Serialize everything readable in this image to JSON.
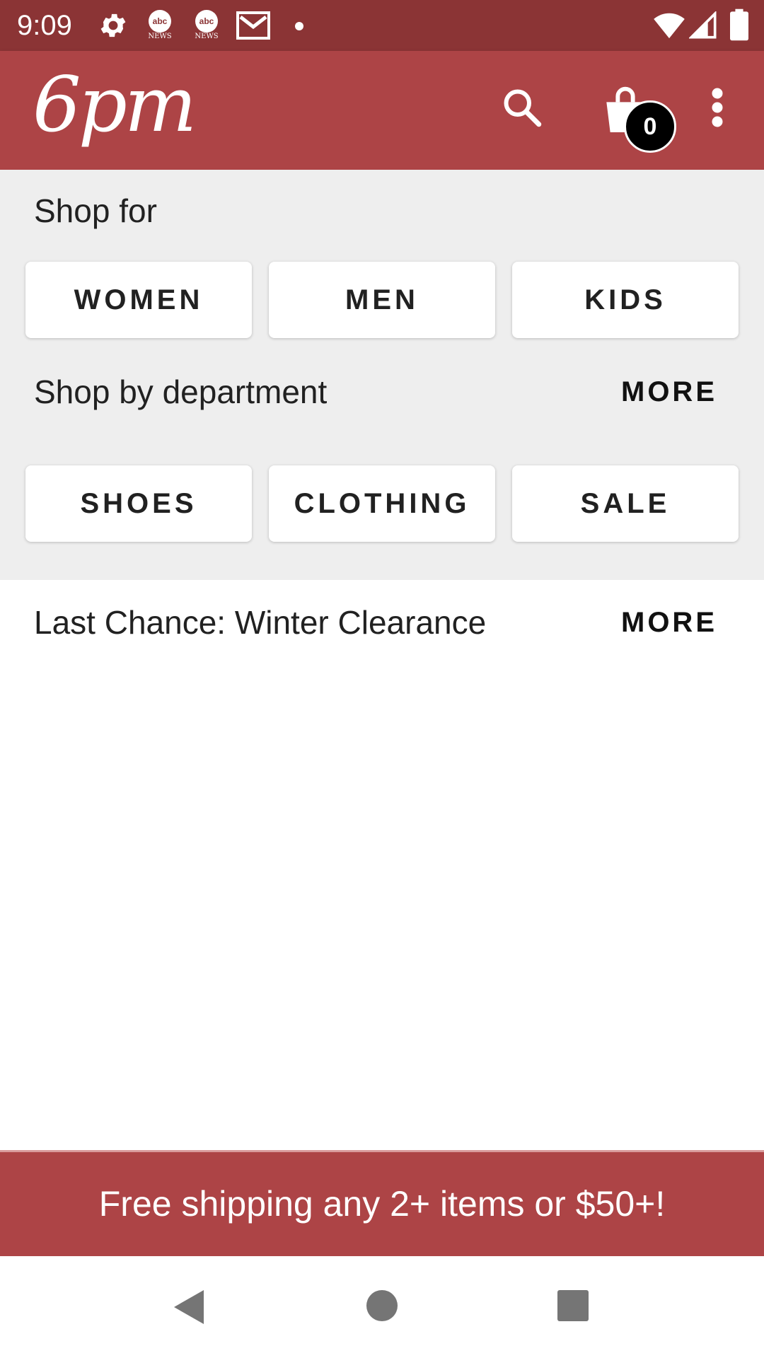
{
  "status_bar": {
    "time": "9:09",
    "icons": [
      "settings-icon",
      "abc-news-icon",
      "abc-news-icon",
      "gmail-icon",
      "dot-icon",
      "wifi-icon",
      "signal-icon",
      "battery-icon"
    ],
    "abc_label": "abc",
    "abc_sub": "NEWS"
  },
  "app_bar": {
    "logo_text": "6pm",
    "cart_count": "0",
    "icons": [
      "search-icon",
      "shopping-bag-icon",
      "overflow-menu-icon"
    ]
  },
  "shop_for": {
    "label": "Shop for",
    "buttons": [
      "WOMEN",
      "MEN",
      "KIDS"
    ]
  },
  "department": {
    "label": "Shop by department",
    "more": "MORE",
    "buttons": [
      "SHOES",
      "CLOTHING",
      "SALE"
    ]
  },
  "clearance": {
    "label": "Last Chance: Winter Clearance",
    "more": "MORE"
  },
  "banner": {
    "text": "Free shipping any 2+ items or $50+!"
  },
  "nav_bar": {
    "icons": [
      "back-icon",
      "home-icon",
      "recents-icon"
    ]
  },
  "colors": {
    "status_bar": "#8b3435",
    "app_bar": "#ad4446",
    "section_bg": "#eeeeee",
    "badge": "#000000"
  }
}
